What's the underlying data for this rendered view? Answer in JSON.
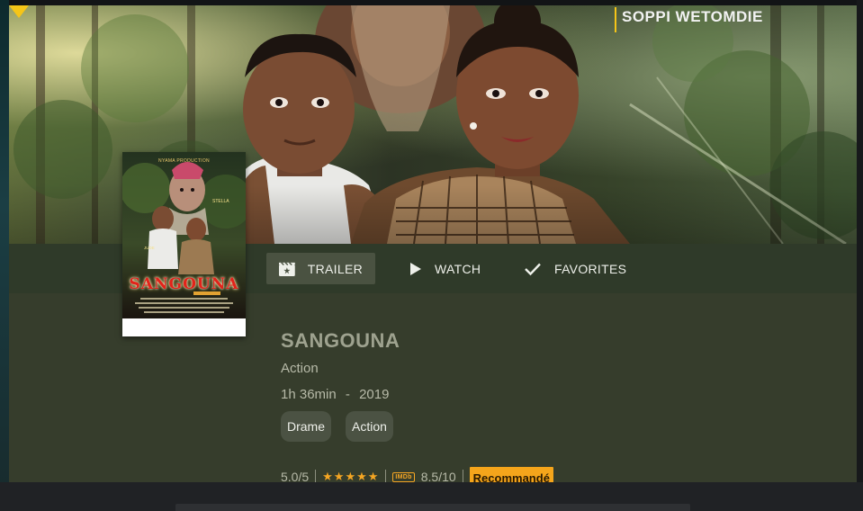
{
  "hero": {
    "brand": "SOPPI WETOMDIE"
  },
  "actions": [
    {
      "label": "TRAILER",
      "icon": "trailer-clapper-icon"
    },
    {
      "label": "WATCH",
      "icon": "play-icon"
    },
    {
      "label": "FAVORITES",
      "icon": "checkmark-icon"
    }
  ],
  "poster": {
    "title": "SANGOUNA",
    "studio": "NYAMA PRODUCTION"
  },
  "movie": {
    "title": "SANGOUNA",
    "genre": "Action",
    "duration": "1h 36min",
    "meta_separator": "-",
    "year": "2019",
    "tags": [
      "Drame",
      "Action"
    ],
    "user_rating": "5.0/5",
    "stars": "★★★★★",
    "imdb_label": "IMDb",
    "imdb_rating": "8.5/10",
    "badge": "Recommandé"
  },
  "colors": {
    "accent": "#f5a623",
    "panel": "#363d2c",
    "action_bar": "#2f3a29",
    "chip": "#4b5243"
  }
}
